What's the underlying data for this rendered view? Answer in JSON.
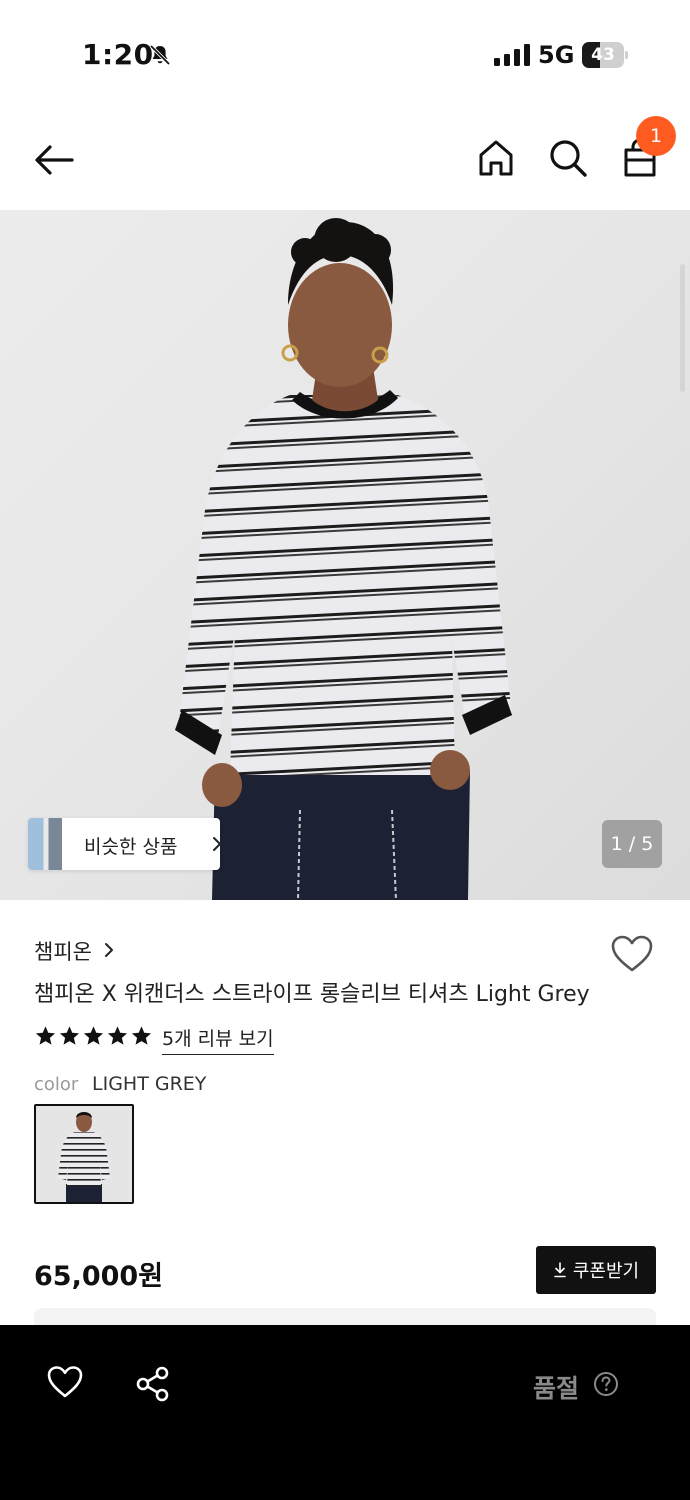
{
  "status_bar": {
    "time": "1:20",
    "network": "5G",
    "battery": "43",
    "battery_level": 0.43
  },
  "nav": {
    "cart_count": "1",
    "icons": [
      "back-arrow-icon",
      "home-icon",
      "search-icon",
      "shopping-bag-icon"
    ]
  },
  "gallery": {
    "similar_label": "비슷한 상품",
    "page_counter": "1 / 5"
  },
  "product": {
    "brand": "챔피온",
    "title": "챔피온 X 위캔더스 스트라이프 롱슬리브 티셔츠 Light Grey",
    "rating_stars": 5,
    "review_link": "5개 리뷰 보기",
    "color_label": "color",
    "color_value": "LIGHT GREY",
    "price": "65,000원",
    "coupon_label": "쿠폰받기"
  },
  "bottom_bar": {
    "status_label": "품절"
  },
  "colors": {
    "accent_badge": "#ff5a1f",
    "bottom_bar_bg": "#000000",
    "coupon_bg": "#111111",
    "muted_text": "#8a8a8a"
  }
}
